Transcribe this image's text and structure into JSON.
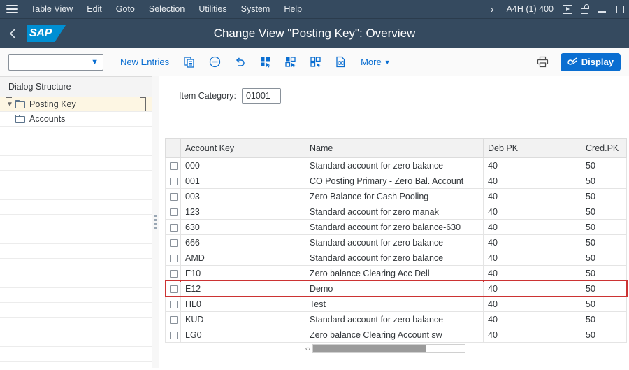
{
  "menubar": {
    "items": [
      {
        "label": "Table View"
      },
      {
        "label": "Edit"
      },
      {
        "label": "Goto"
      },
      {
        "label": "Selection"
      },
      {
        "label": "Utilities"
      },
      {
        "label": "System"
      },
      {
        "label": "Help"
      }
    ],
    "chevron": "›",
    "system_info": "A4H (1) 400"
  },
  "titlebar": {
    "logo_text": "SAP",
    "title": "Change View \"Posting Key\": Overview"
  },
  "toolbar": {
    "variant_value": "",
    "variant_placeholder": "",
    "new_entries_label": "New Entries",
    "more_label": "More",
    "display_label": "Display",
    "icons": {
      "copy": "copy-icon",
      "delete": "delete-icon",
      "undo": "undo-icon",
      "select_all": "select-all-icon",
      "select_block": "select-block-icon",
      "deselect_all": "deselect-all-icon",
      "find": "find-icon",
      "print": "print-icon"
    }
  },
  "sidebar": {
    "header": "Dialog Structure",
    "items": [
      {
        "label": "Posting Key",
        "selected": true,
        "level": 0,
        "expanded": true
      },
      {
        "label": "Accounts",
        "selected": false,
        "level": 1,
        "expanded": false
      }
    ]
  },
  "main": {
    "item_category_label": "Item Category:",
    "item_category_value": "01001"
  },
  "table": {
    "columns": [
      "Account Key",
      "Name",
      "Deb PK",
      "Cred.PK"
    ],
    "rows": [
      {
        "key": "000",
        "name": "Standard account for zero balance",
        "deb": "40",
        "cred": "50",
        "highlight": false
      },
      {
        "key": "001",
        "name": "CO Posting Primary - Zero Bal. Account",
        "deb": "40",
        "cred": "50",
        "highlight": false
      },
      {
        "key": "003",
        "name": "Zero Balance for Cash Pooling",
        "deb": "40",
        "cred": "50",
        "highlight": false
      },
      {
        "key": "123",
        "name": "Standard account for zero manak",
        "deb": "40",
        "cred": "50",
        "highlight": false
      },
      {
        "key": "630",
        "name": "Standard account for zero balance-630",
        "deb": "40",
        "cred": "50",
        "highlight": false
      },
      {
        "key": "666",
        "name": "Standard account for zero balance",
        "deb": "40",
        "cred": "50",
        "highlight": false
      },
      {
        "key": "AMD",
        "name": "Standard account for zero balance",
        "deb": "40",
        "cred": "50",
        "highlight": false
      },
      {
        "key": "E10",
        "name": "Zero balance Clearing Acc Dell",
        "deb": "40",
        "cred": "50",
        "highlight": false
      },
      {
        "key": "E12",
        "name": "Demo",
        "deb": "40",
        "cred": "50",
        "highlight": true
      },
      {
        "key": "HL0",
        "name": "Test",
        "deb": "40",
        "cred": "50",
        "highlight": false
      },
      {
        "key": "KUD",
        "name": "Standard account for zero balance",
        "deb": "40",
        "cred": "50",
        "highlight": false
      },
      {
        "key": "LG0",
        "name": "Zero balance Clearing Account sw",
        "deb": "40",
        "cred": "50",
        "highlight": false
      }
    ],
    "scroll_left_arrow": "‹",
    "scroll_right_arrow": "›"
  },
  "colors": {
    "shell_bg": "#354a5f",
    "accent": "#0a6ed1",
    "logo_blue": "#008fd3",
    "highlight_row_border": "#cc3333",
    "tree_selected_bg": "#fdf6e3"
  }
}
